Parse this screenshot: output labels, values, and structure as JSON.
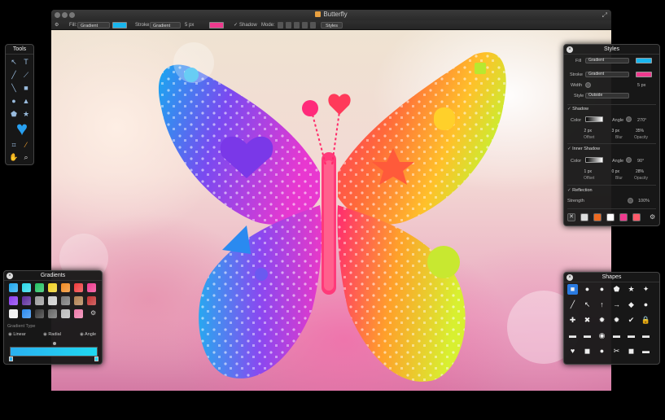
{
  "window": {
    "title": "Butterfly",
    "toolbar": {
      "fill_label": "Fill:",
      "fill_value": "Gradient",
      "fill_color": "#19b6ee",
      "stroke_label": "Stroke:",
      "stroke_value": "Gradient",
      "stroke_width": "5 px",
      "stroke_color": "#ee3a8e",
      "shadow_label": "Shadow",
      "mode_label": "Mode:",
      "styles_button": "Styles"
    }
  },
  "tools_panel": {
    "title": "Tools",
    "tools": [
      "select-arrow",
      "text-tool",
      "pen-tool",
      "line-tool",
      "rectangle-tool",
      "ellipse-tool",
      "polygon-tool",
      "star-tool",
      "heart-shape-tool",
      "crop-tool",
      "eyedropper-tool",
      "hand-tool",
      "zoom-tool"
    ]
  },
  "styles_panel": {
    "title": "Styles",
    "fill_label": "Fill",
    "fill_value": "Gradient",
    "stroke_label": "Stroke",
    "stroke_value": "Gradient",
    "width_label": "Width",
    "width_value": "5 px",
    "style_label": "Style",
    "style_value": "Outside",
    "shadow": {
      "label": "Shadow",
      "color_label": "Color",
      "angle_label": "Angle",
      "angle_value": "270°",
      "offset_value": "2 px",
      "blur_value": "3 px",
      "opacity_value": "35%",
      "offset_label": "Offset",
      "blur_label": "Blur",
      "opacity_label": "Opacity"
    },
    "inner_shadow": {
      "label": "Inner Shadow",
      "color_label": "Color",
      "angle_label": "Angle",
      "angle_value": "90°",
      "offset_value": "1 px",
      "blur_value": "0 px",
      "opacity_value": "28%",
      "offset_label": "Offset",
      "blur_label": "Blur",
      "opacity_label": "Opacity"
    },
    "reflection": {
      "label": "Reflection",
      "strength_label": "Strength",
      "strength_value": "100%"
    },
    "preset_colors": [
      "#dddddd",
      "#ee6a22",
      "#ffffff",
      "#ee3a8e",
      "#ff5a6a"
    ]
  },
  "gradients_panel": {
    "title": "Gradients",
    "swatches": [
      "#1ea8ee",
      "#28d8e8",
      "#20c060",
      "#f0d020",
      "#f08a20",
      "#ee3a3a",
      "#ee3a8e",
      "#8a3aee",
      "#5a2a9a",
      "#9a9a9a",
      "#cccccc",
      "#777777",
      "#b08050",
      "#c03030",
      "#eeeeee",
      "#2a8aee",
      "#333333",
      "#666666",
      "#bbbbbb",
      "#ee7aaa"
    ],
    "type_label": "Gradient Type",
    "types": [
      "Linear",
      "Radial",
      "Angle"
    ]
  },
  "shapes_panel": {
    "title": "Shapes",
    "shapes": [
      "■",
      "●",
      "●",
      "⬟",
      "★",
      "✦",
      "╱",
      "↖",
      "↑",
      "→",
      "◆",
      "●",
      "✚",
      "✖",
      "✹",
      "✹",
      "✔",
      "🔒",
      "▬",
      "▬",
      "◉",
      "▬",
      "▬",
      "▬",
      "♥",
      "◼",
      "●",
      "✂",
      "◼",
      "▬"
    ]
  },
  "colors": {
    "accent_blue": "#19b6ee",
    "accent_pink": "#ee3a8e"
  }
}
